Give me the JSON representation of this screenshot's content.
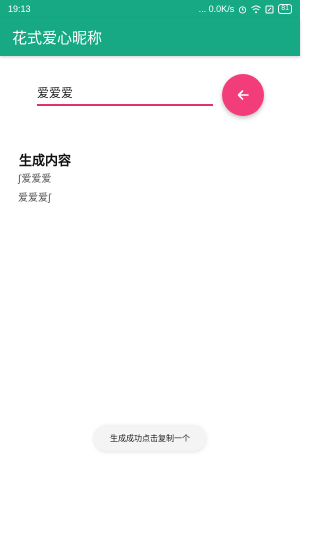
{
  "status_bar": {
    "time": "19:13",
    "speed": "... 0.0K/s",
    "battery": "81"
  },
  "app_bar": {
    "title": "花式爱心昵称"
  },
  "input": {
    "value": "爱爱爱"
  },
  "fab": {
    "icon": "arrow-left-icon",
    "color": "#f23d7a"
  },
  "results": {
    "title": "生成内容",
    "lines": [
      "ʃ爱爱爱",
      "爱爱爱ʃ"
    ]
  },
  "toast": {
    "text": "生成成功点击复制一个"
  },
  "colors": {
    "primary": "#17a984",
    "accent": "#f23d7a",
    "underline": "#e0336e"
  }
}
